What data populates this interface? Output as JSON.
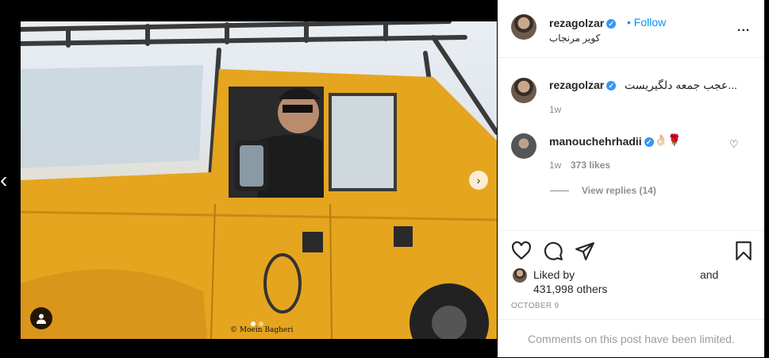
{
  "post": {
    "username": "rezagolzar",
    "follow_separator": "•",
    "follow_label": "Follow",
    "location": "کویر مرنجاب",
    "more_label": "..."
  },
  "media": {
    "prev_label": "‹",
    "next_label": "›",
    "credit": "© Moein Bagheri",
    "slide_count": 2,
    "current_slide": 1
  },
  "comments": [
    {
      "username": "rezagolzar",
      "text": "عجب جمعه دلگیریست...",
      "time": "1w"
    },
    {
      "username": "manouchehrhadii",
      "text": "👌🏻🌹",
      "time": "1w",
      "likes": "373 likes",
      "view_replies": "View replies (14)"
    }
  ],
  "likes": {
    "prefix": "Liked by",
    "and": "and",
    "others": "431,998 others"
  },
  "date": "OCTOBER 9",
  "footer": "Comments on this post have been limited.",
  "icons": {
    "verified": "verified-badge-icon",
    "heart": "heart-icon",
    "comment": "comment-icon",
    "share": "share-icon",
    "save": "bookmark-icon",
    "user_tag": "user-tag-icon"
  },
  "colors": {
    "accent": "#0095f6",
    "verified": "#3897f0",
    "muted": "#8e8e8e",
    "text": "#262626",
    "jeep": "#e6a51f"
  }
}
